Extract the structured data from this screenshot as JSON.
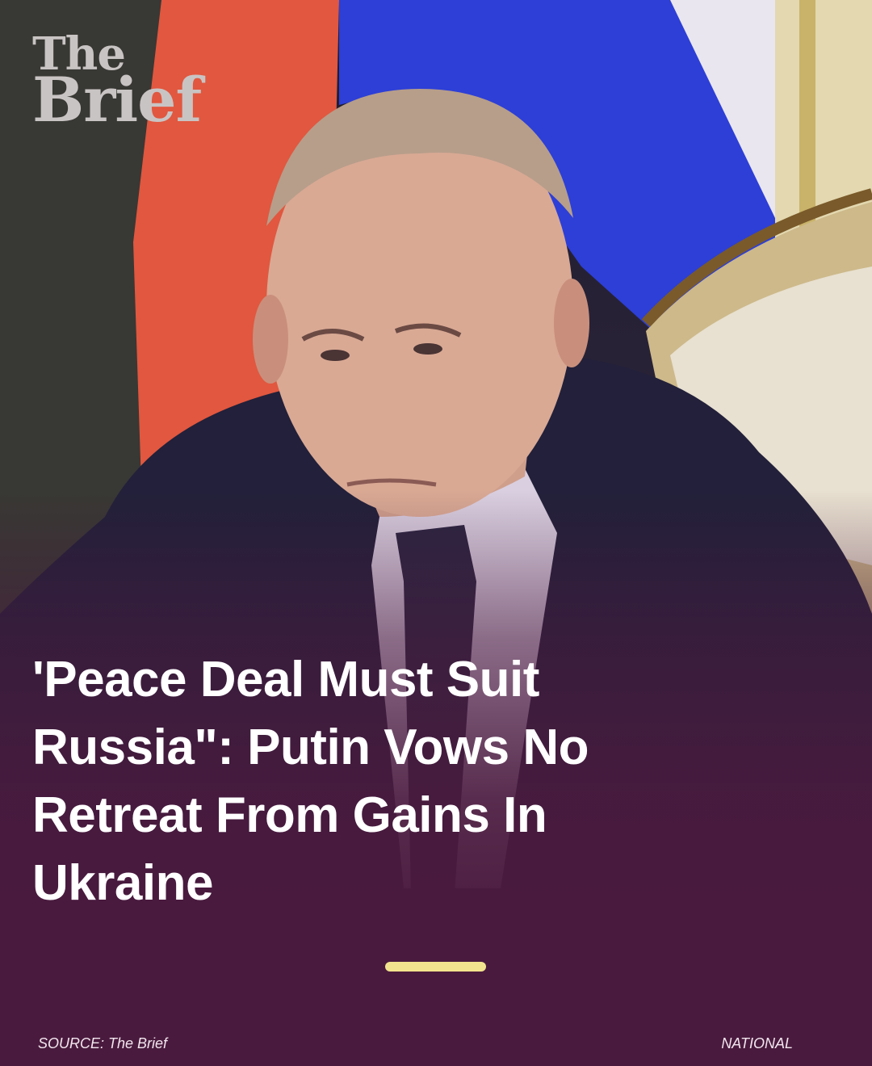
{
  "brand": {
    "line1": "The",
    "line2": "Brief"
  },
  "headline": "'Peace Deal Must Suit Russia\": Putin Vows No Retreat From Gains In Ukraine",
  "footer": {
    "source": "SOURCE: The Brief",
    "category": "NATIONAL"
  },
  "colors": {
    "background": "#4a1a3e",
    "accent_pager": "#f2e48e",
    "text": "#ffffff"
  }
}
